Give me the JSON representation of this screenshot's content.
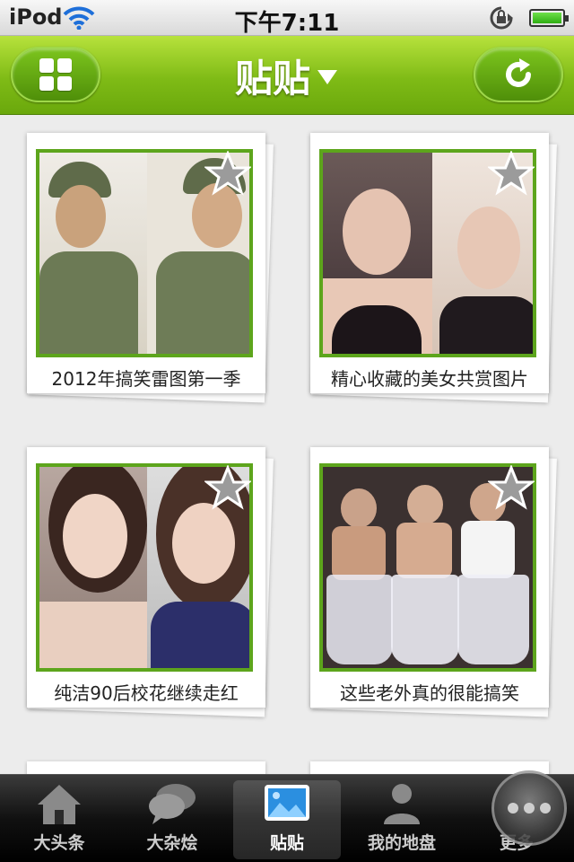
{
  "status_bar": {
    "carrier": "iPod",
    "time": "下午7:11",
    "icons": [
      "wifi-icon",
      "rotation-lock-icon",
      "battery-icon"
    ],
    "battery_level": 1.0
  },
  "nav": {
    "title": "贴贴",
    "left_button": "grid-icon",
    "right_button": "refresh-icon",
    "accent": "#7fbb16"
  },
  "cards": [
    {
      "caption": "2012年搞笑雷图第一季"
    },
    {
      "caption": "精心收藏的美女共赏图片"
    },
    {
      "caption": "纯洁90后校花继续走红"
    },
    {
      "caption": "这些老外真的很能搞笑"
    }
  ],
  "tabs": [
    {
      "label": "大头条",
      "icon": "home-icon",
      "active": false
    },
    {
      "label": "大杂烩",
      "icon": "chat-bubbles-icon",
      "active": false
    },
    {
      "label": "贴贴",
      "icon": "picture-icon",
      "active": true
    },
    {
      "label": "我的地盘",
      "icon": "person-icon",
      "active": false
    },
    {
      "label": "更多",
      "icon": "more-icon",
      "active": false
    }
  ]
}
